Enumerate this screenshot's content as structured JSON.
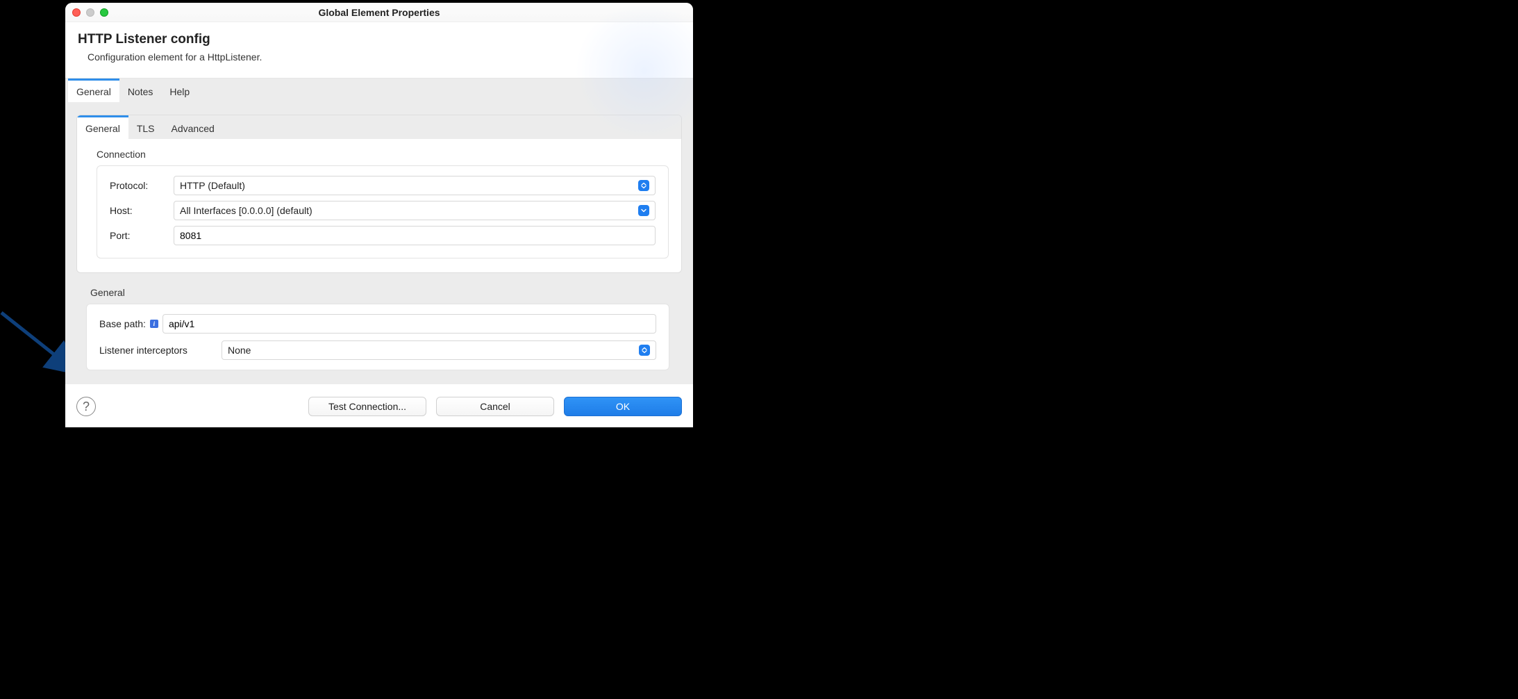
{
  "window": {
    "title": "Global Element Properties"
  },
  "header": {
    "title": "HTTP Listener config",
    "subtitle": "Configuration element for a HttpListener."
  },
  "outer_tabs": {
    "items": [
      {
        "label": "General",
        "active": true
      },
      {
        "label": "Notes",
        "active": false
      },
      {
        "label": "Help",
        "active": false
      }
    ]
  },
  "inner_tabs": {
    "items": [
      {
        "label": "General",
        "active": true
      },
      {
        "label": "TLS",
        "active": false
      },
      {
        "label": "Advanced",
        "active": false
      }
    ]
  },
  "connection": {
    "group_label": "Connection",
    "protocol_label": "Protocol:",
    "protocol_value": "HTTP (Default)",
    "host_label": "Host:",
    "host_value": "All Interfaces [0.0.0.0] (default)",
    "port_label": "Port:",
    "port_value": "8081"
  },
  "general": {
    "group_label": "General",
    "base_path_label": "Base path:",
    "base_path_value": "api/v1",
    "listener_interceptors_label": "Listener interceptors",
    "listener_interceptors_value": "None"
  },
  "buttons": {
    "test_connection": "Test Connection...",
    "cancel": "Cancel",
    "ok": "OK"
  }
}
